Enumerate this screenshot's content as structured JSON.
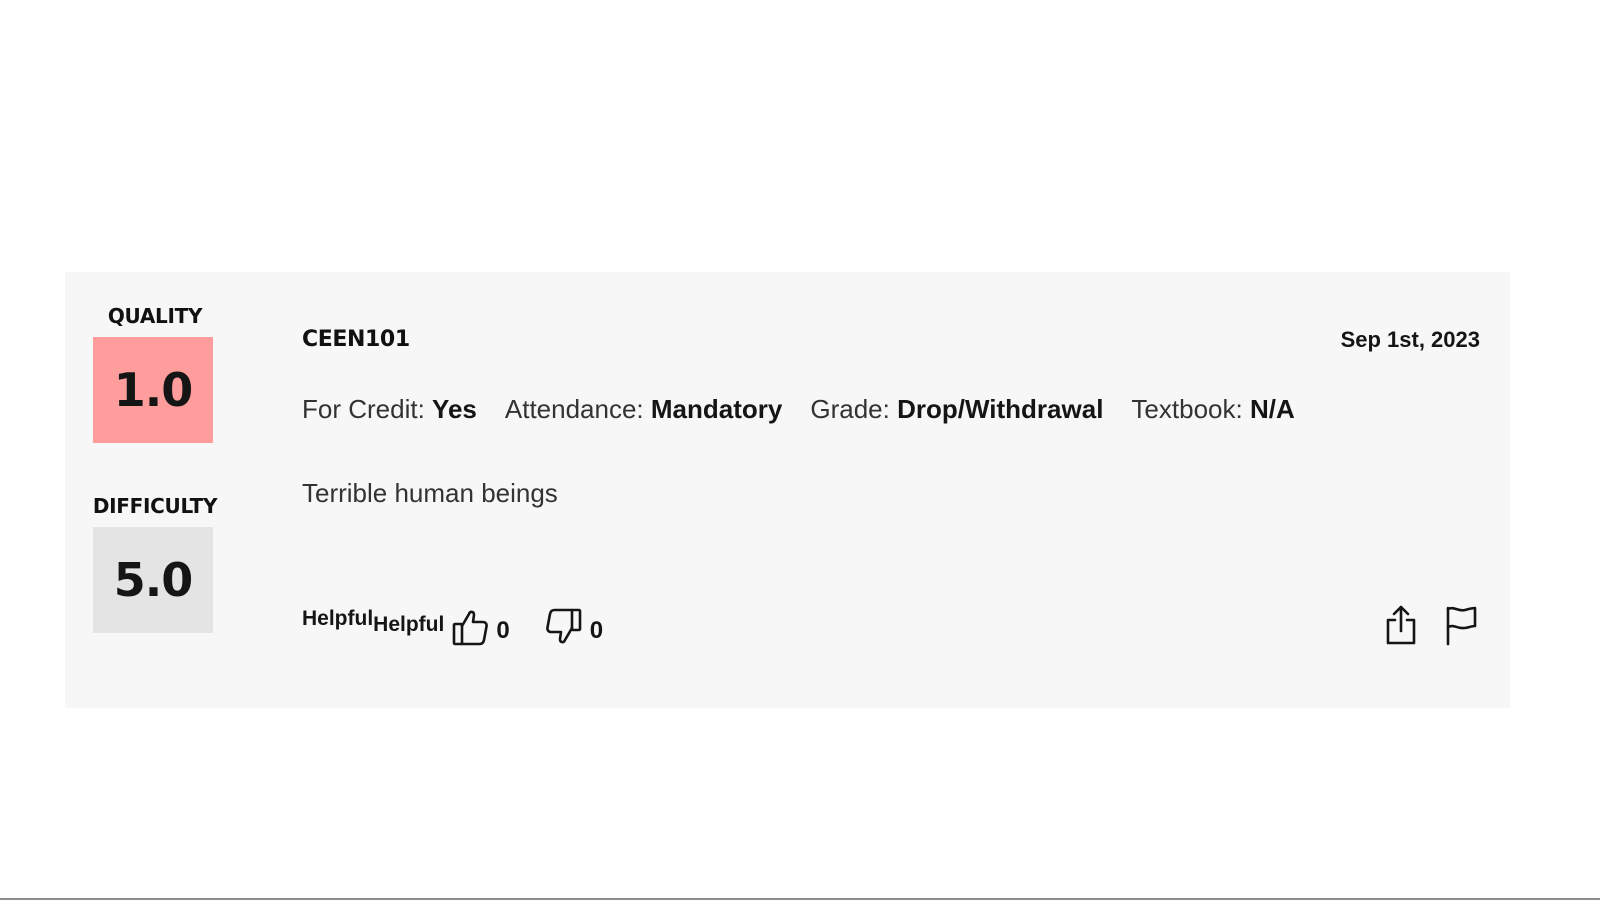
{
  "rating": {
    "quality_label": "QUALITY",
    "quality_value": "1.0",
    "difficulty_label": "DIFFICULTY",
    "difficulty_value": "5.0",
    "course": "CEEN101",
    "date": "Sep 1st, 2023",
    "meta": [
      {
        "label": "For Credit:",
        "value": "Yes"
      },
      {
        "label": "Attendance:",
        "value": "Mandatory"
      },
      {
        "label": "Grade:",
        "value": "Drop/Withdrawal"
      },
      {
        "label": "Textbook:",
        "value": "N/A"
      }
    ],
    "comment": "Terrible human beings",
    "helpful_label_1": "Helpful",
    "helpful_label_2": "Helpful",
    "thumbs_up_count": "0",
    "thumbs_down_count": "0"
  },
  "icons": {
    "thumbs_up": "thumbs-up-icon",
    "thumbs_down": "thumbs-down-icon",
    "share": "share-icon",
    "flag": "flag-icon"
  },
  "colors": {
    "quality_bg": "#ff9c9c",
    "difficulty_bg": "#e4e4e4",
    "card_bg": "#f7f7f7"
  }
}
